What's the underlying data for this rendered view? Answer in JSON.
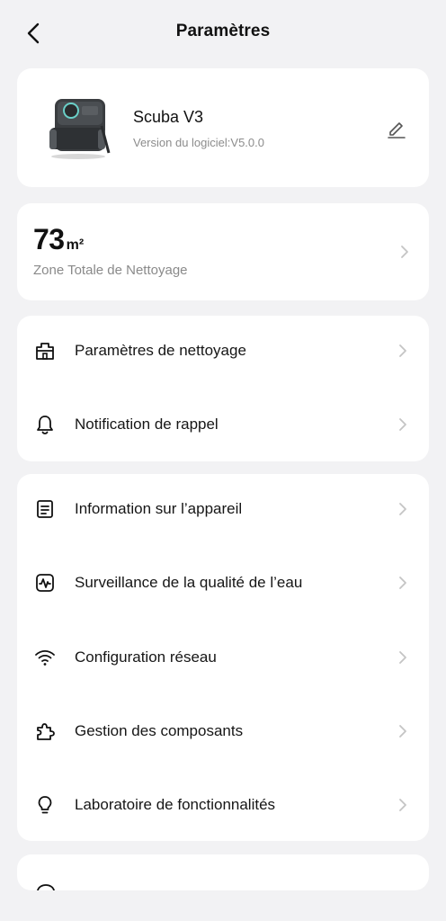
{
  "header": {
    "title": "Paramètres"
  },
  "device": {
    "name": "Scuba V3",
    "version": "Version du logiciel:V5.0.0"
  },
  "area": {
    "value": "73",
    "unit": "m²",
    "label": "Zone Totale de Nettoyage"
  },
  "menu_group_1": [
    {
      "label": "Paramètres de nettoyage",
      "icon": "building-icon"
    },
    {
      "label": "Notification de rappel",
      "icon": "bell-icon"
    }
  ],
  "menu_group_2": [
    {
      "label": "Information sur l’appareil",
      "icon": "document-icon"
    },
    {
      "label": "Surveillance de la qualité de l’eau",
      "icon": "waveform-icon"
    },
    {
      "label": "Configuration réseau",
      "icon": "wifi-icon"
    },
    {
      "label": "Gestion des composants",
      "icon": "puzzle-icon"
    },
    {
      "label": "Laboratoire de fonctionnalités",
      "icon": "lightbulb-icon"
    }
  ],
  "colors": {
    "background": "#f2f2f4",
    "card": "#ffffff",
    "text": "#111111",
    "secondary_text": "#8c8c8c",
    "chevron": "#c4c4c4"
  }
}
